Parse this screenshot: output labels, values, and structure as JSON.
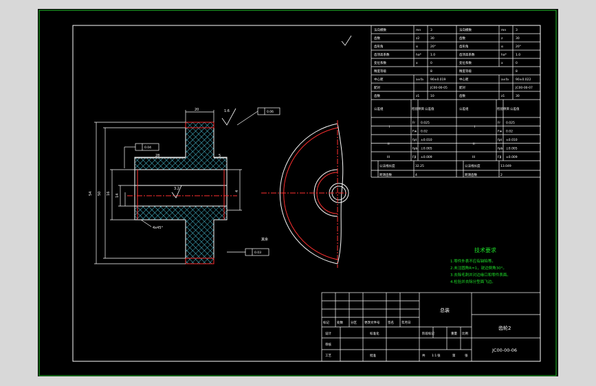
{
  "drawing": {
    "title_text": "技术要求",
    "notes": [
      "1.零件外表不应有缺陷等。",
      "2.未注圆角R=1，锐边倒角30°。",
      "3.去除毛刺并对边缘口和零件表面。",
      "4.检验并去除分型面飞边。"
    ],
    "surface_note": "其余",
    "surface_value": "3.2",
    "part_name": "齿轮2",
    "company": "总装",
    "drawing_number": "JC00-00-06",
    "scale": "1:1",
    "dims": {
      "width": "20",
      "hub_len": "28",
      "gap": "5",
      "bore": "14",
      "od": "54",
      "pitch": "50",
      "hub_d": "16",
      "small_d": "4",
      "chamfer": "4x45°",
      "face_roughness": "1.6",
      "tol1": "0.06",
      "tol2": "0.04",
      "tol3": "0.03"
    },
    "table_left": [
      [
        "法向模数",
        "mn",
        "3"
      ],
      [
        "齿数",
        "z2",
        "30"
      ],
      [
        "齿形角",
        "α",
        "20°"
      ],
      [
        "齿顶高系数",
        "ha*",
        "1.0"
      ],
      [
        "变位系数",
        "x",
        "0"
      ],
      [
        "精度等级",
        "",
        "8"
      ],
      [
        "中心距",
        "a±fa",
        "90±0.019"
      ],
      [
        "配对",
        "",
        "JC00-00-05"
      ],
      [
        "齿数",
        "z1",
        "10"
      ]
    ],
    "table_right": [
      [
        "法向模数",
        "mn",
        "3"
      ],
      [
        "齿数",
        "z",
        "30"
      ],
      [
        "齿形角",
        "α",
        "20°"
      ],
      [
        "齿顶高系数",
        "ha*",
        "1.0"
      ],
      [
        "变位系数",
        "x",
        "0"
      ],
      [
        "精度等级",
        "",
        "8"
      ],
      [
        "中心距",
        "a±fa",
        "90±0.022"
      ],
      [
        "配对",
        "",
        "JC00-00-07"
      ],
      [
        "齿数",
        "z1",
        "30"
      ]
    ],
    "table_groups": [
      [
        "Fr",
        "0.025",
        "Fr",
        "0.025"
      ],
      [
        "Fw",
        "0.02",
        "Fw",
        "0.02"
      ],
      [
        "fpt",
        "±0.010",
        "fpt",
        "±0.010"
      ],
      [
        "fpb",
        "±0.005",
        "fpb",
        "±0.005"
      ],
      [
        "Fβ",
        "±0.009",
        "Fβ",
        "±0.009"
      ]
    ],
    "table_groups_labels": [
      "I",
      "II",
      "III"
    ],
    "table_heads": [
      "公差组",
      "检验项目",
      "公差值"
    ],
    "table_bottom": [
      [
        "公法线长度",
        "32.25",
        "13.049"
      ],
      [
        "跨测齿数",
        "4",
        "2"
      ]
    ],
    "title_block": {
      "rows": [
        "标记",
        "处数",
        "分区",
        "更改文件号",
        "签名",
        "年月日"
      ],
      "left_labels": [
        "设计",
        "审核",
        "工艺"
      ],
      "mid_labels": [
        "标准化",
        "批准"
      ],
      "stage_labels": [
        "阶段标记",
        "重量",
        "比例"
      ],
      "sheet_labels": [
        "共",
        "张",
        "第",
        "张"
      ]
    }
  }
}
